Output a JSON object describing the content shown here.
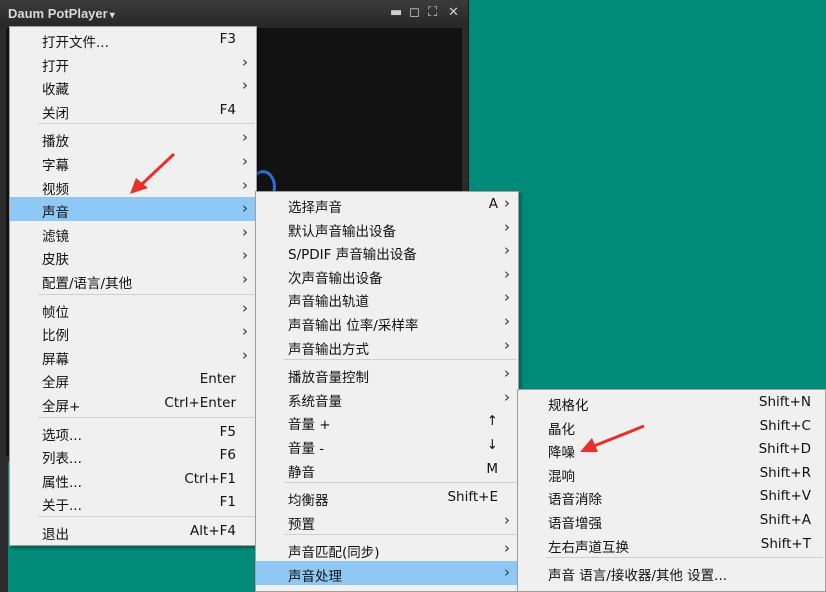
{
  "app": {
    "title": "Daum PotPlayer",
    "title_caret": "▾"
  },
  "window_controls": {
    "minimize": "▬",
    "restore": "◻",
    "fullscreen": "⛶",
    "close": "✕"
  },
  "main_menu": {
    "items": [
      {
        "label": "打开文件...",
        "shortcut": "F3",
        "arrow": ""
      },
      {
        "label": "打开",
        "shortcut": "",
        "arrow": "›"
      },
      {
        "label": "收藏",
        "shortcut": "",
        "arrow": "›"
      },
      {
        "label": "关闭",
        "shortcut": "F4",
        "arrow": ""
      },
      {
        "label": "播放",
        "shortcut": "",
        "arrow": "›"
      },
      {
        "label": "字幕",
        "shortcut": "",
        "arrow": "›"
      },
      {
        "label": "视频",
        "shortcut": "",
        "arrow": "›"
      },
      {
        "label": "声音",
        "shortcut": "",
        "arrow": "›"
      },
      {
        "label": "滤镜",
        "shortcut": "",
        "arrow": "›"
      },
      {
        "label": "皮肤",
        "shortcut": "",
        "arrow": "›"
      },
      {
        "label": "配置/语言/其他",
        "shortcut": "",
        "arrow": "›"
      },
      {
        "label": "帧位",
        "shortcut": "",
        "arrow": "›"
      },
      {
        "label": "比例",
        "shortcut": "",
        "arrow": "›"
      },
      {
        "label": "屏幕",
        "shortcut": "",
        "arrow": "›"
      },
      {
        "label": "全屏",
        "shortcut": "Enter",
        "arrow": ""
      },
      {
        "label": "全屏+",
        "shortcut": "Ctrl+Enter",
        "arrow": ""
      },
      {
        "label": "选项...",
        "shortcut": "F5",
        "arrow": ""
      },
      {
        "label": "列表...",
        "shortcut": "F6",
        "arrow": ""
      },
      {
        "label": "属性...",
        "shortcut": "Ctrl+F1",
        "arrow": ""
      },
      {
        "label": "关于...",
        "shortcut": "F1",
        "arrow": ""
      },
      {
        "label": "退出",
        "shortcut": "Alt+F4",
        "arrow": ""
      }
    ],
    "highlighted_label": "声音"
  },
  "audio_menu": {
    "items": [
      {
        "label": "选择声音",
        "shortcut": "A",
        "arrow": "›"
      },
      {
        "label": "默认声音输出设备",
        "shortcut": "",
        "arrow": "›"
      },
      {
        "label": "S/PDIF 声音输出设备",
        "shortcut": "",
        "arrow": "›"
      },
      {
        "label": "次声音输出设备",
        "shortcut": "",
        "arrow": "›"
      },
      {
        "label": "声音输出轨道",
        "shortcut": "",
        "arrow": "›"
      },
      {
        "label": "声音输出 位率/采样率",
        "shortcut": "",
        "arrow": "›"
      },
      {
        "label": "声音输出方式",
        "shortcut": "",
        "arrow": "›"
      },
      {
        "label": "播放音量控制",
        "shortcut": "",
        "arrow": "›"
      },
      {
        "label": "系统音量",
        "shortcut": "",
        "arrow": "›"
      },
      {
        "label": "音量 +",
        "shortcut": "↑",
        "arrow": ""
      },
      {
        "label": "音量 -",
        "shortcut": "↓",
        "arrow": ""
      },
      {
        "label": "静音",
        "shortcut": "M",
        "arrow": ""
      },
      {
        "label": "均衡器",
        "shortcut": "Shift+E",
        "arrow": ""
      },
      {
        "label": "预置",
        "shortcut": "",
        "arrow": "›"
      },
      {
        "label": "声音匹配(同步)",
        "shortcut": "",
        "arrow": "›"
      },
      {
        "label": "声音处理",
        "shortcut": "",
        "arrow": "›"
      }
    ],
    "highlighted_label": "声音处理"
  },
  "audio_processing_menu": {
    "items": [
      {
        "label": "规格化",
        "shortcut": "Shift+N"
      },
      {
        "label": "晶化",
        "shortcut": "Shift+C"
      },
      {
        "label": "降噪",
        "shortcut": "Shift+D"
      },
      {
        "label": "混响",
        "shortcut": "Shift+R"
      },
      {
        "label": "语音消除",
        "shortcut": "Shift+V"
      },
      {
        "label": "语音增强",
        "shortcut": "Shift+A"
      },
      {
        "label": "左右声道互换",
        "shortcut": "Shift+T"
      },
      {
        "label": "声音 语言/接收器/其他 设置...",
        "shortcut": ""
      }
    ]
  },
  "colors": {
    "desktop": "#008a78",
    "menu_bg": "#f0f0f0",
    "highlight": "#8fc8f5",
    "annotation_arrow": "#e8302a"
  }
}
